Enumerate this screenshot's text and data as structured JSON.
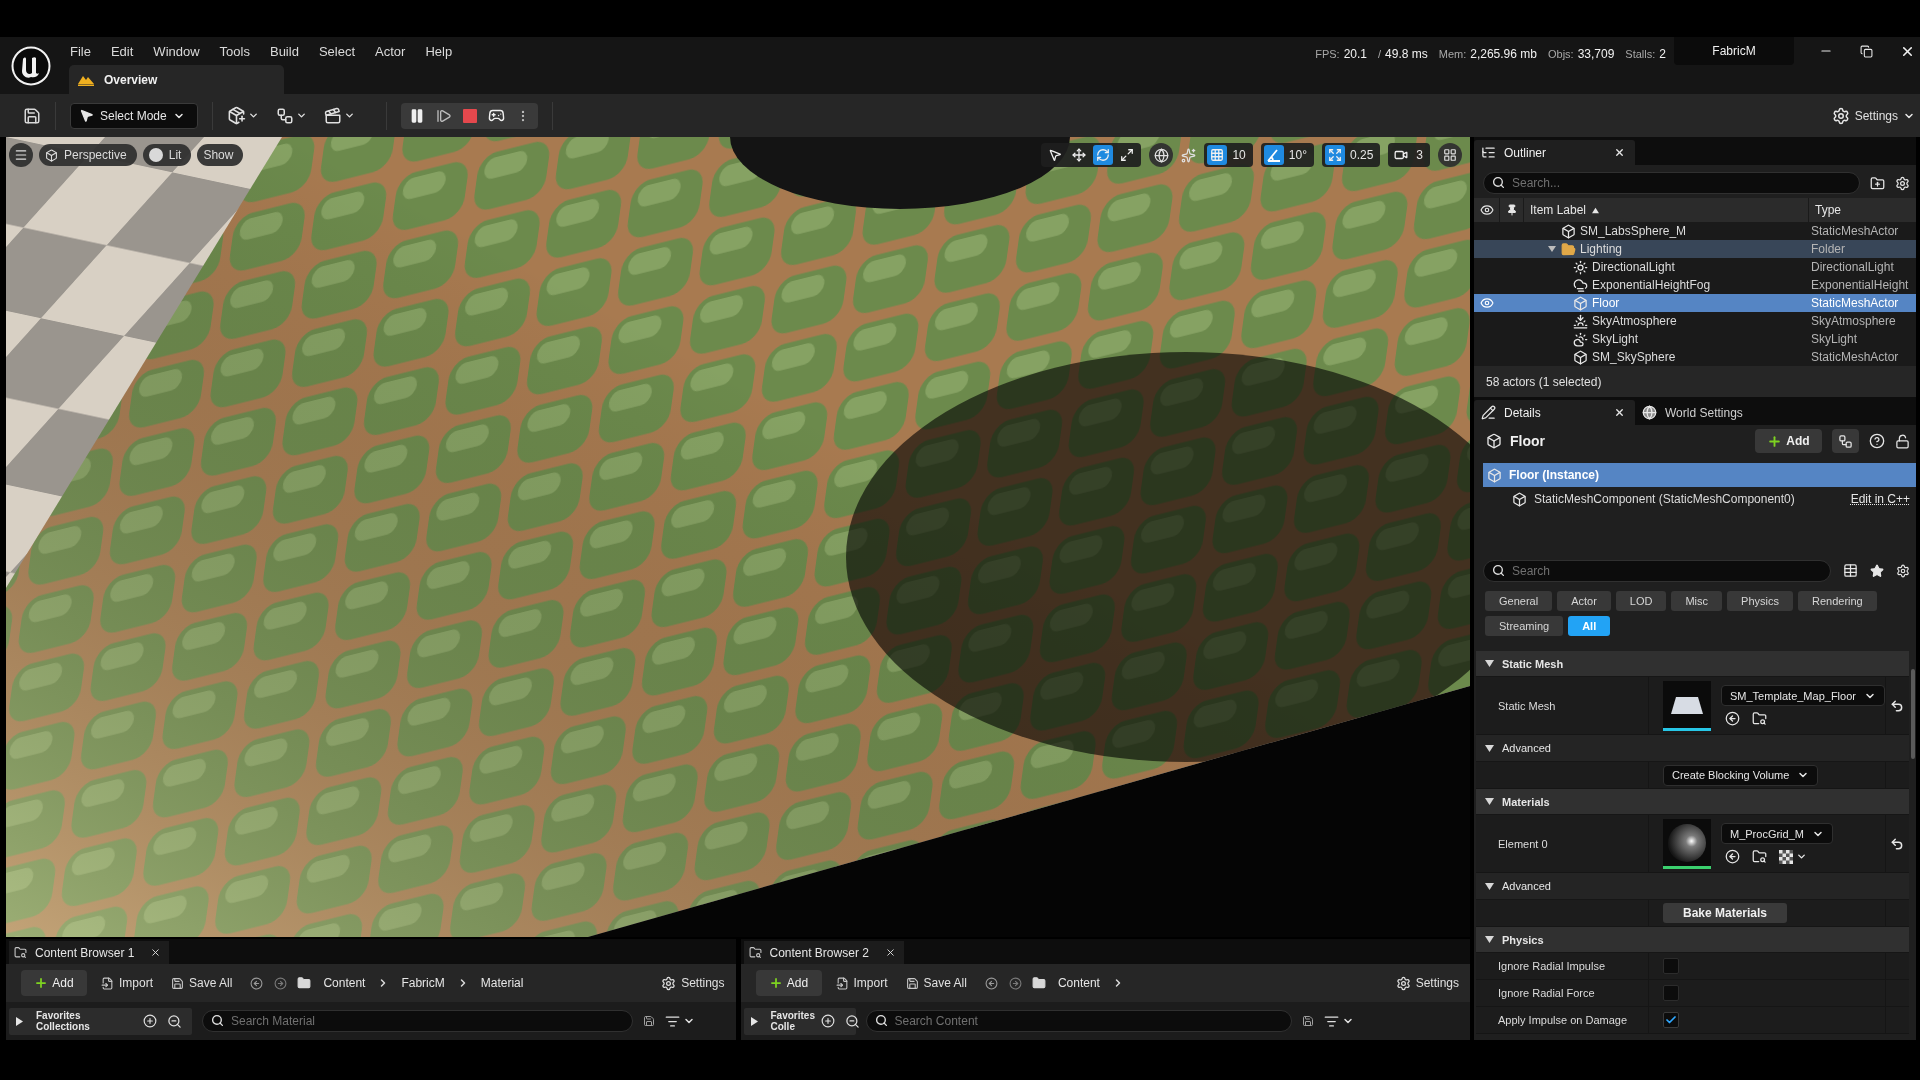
{
  "title_bar": {
    "menus": [
      "File",
      "Edit",
      "Window",
      "Tools",
      "Build",
      "Select",
      "Actor",
      "Help"
    ],
    "level_tab": "Overview",
    "stats": [
      {
        "label": "FPS:",
        "value": "20.1"
      },
      {
        "label": "/",
        "value": "49.8 ms"
      },
      {
        "label": "Mem:",
        "value": "2,265.96 mb"
      },
      {
        "label": "Objs:",
        "value": "33,709"
      },
      {
        "label": "Stalls:",
        "value": "2"
      }
    ],
    "project": "FabricM"
  },
  "toolbar": {
    "mode": "Select Mode",
    "settings": "Settings"
  },
  "viewport": {
    "menu_buttons": [
      {
        "label": "Perspective",
        "kind": "perspective"
      },
      {
        "label": "Lit",
        "kind": "lit"
      },
      {
        "label": "Show",
        "kind": "text"
      }
    ],
    "tools": [
      {
        "kind": "select",
        "selected": false
      },
      {
        "kind": "move",
        "selected": false
      },
      {
        "kind": "rotate",
        "selected": true
      },
      {
        "kind": "scale",
        "selected": false
      }
    ],
    "snaps": [
      {
        "kind": "grid",
        "value": "10",
        "on": true
      },
      {
        "kind": "angle",
        "value": "10°",
        "on": true
      },
      {
        "kind": "scale",
        "value": "0.25",
        "on": true
      },
      {
        "kind": "camera",
        "value": "3",
        "on": false
      }
    ]
  },
  "outliner": {
    "title": "Outliner",
    "search": {
      "placeholder": "Search..."
    },
    "columns": [
      "Item Label",
      "Type"
    ],
    "rows": [
      {
        "label": "SM_LabsSphere_M",
        "type": "StaticMeshActor",
        "kind": "mesh",
        "selected": false,
        "highlighted": false
      },
      {
        "label": "Lighting",
        "type": "Folder",
        "kind": "folder",
        "selected": false,
        "highlighted": true,
        "expanded": true,
        "children": [
          {
            "label": "DirectionalLight",
            "type": "DirectionalLight",
            "kind": "sun",
            "selected": false,
            "highlighted": false
          },
          {
            "label": "ExponentialHeightFog",
            "type": "ExponentialHeight",
            "kind": "fog",
            "selected": false,
            "highlighted": false
          },
          {
            "label": "Floor",
            "type": "StaticMeshActor",
            "kind": "mesh",
            "selected": true,
            "highlighted": false
          },
          {
            "label": "SkyAtmosphere",
            "type": "SkyAtmosphere",
            "kind": "atmosphere",
            "selected": false,
            "highlighted": false
          },
          {
            "label": "SkyLight",
            "type": "SkyLight",
            "kind": "skylight",
            "selected": false,
            "highlighted": false
          },
          {
            "label": "SM_SkySphere",
            "type": "StaticMeshActor",
            "kind": "mesh",
            "selected": false,
            "highlighted": false
          }
        ]
      }
    ],
    "status": "58 actors (1 selected)"
  },
  "details": {
    "tabs": [
      {
        "label": "Details",
        "selected": true
      },
      {
        "label": "World Settings",
        "selected": false
      }
    ],
    "actor": "Floor",
    "add": "Add",
    "components": [
      {
        "label": "Floor (Instance)",
        "selected": true,
        "children": [
          {
            "label": "StaticMeshComponent (StaticMeshComponent0)",
            "selected": false,
            "link": "Edit in C++"
          }
        ]
      }
    ],
    "search": {
      "placeholder": "Search"
    },
    "filters": [
      {
        "label": "General",
        "selected": false
      },
      {
        "label": "Actor",
        "selected": false
      },
      {
        "label": "LOD",
        "selected": false
      },
      {
        "label": "Misc",
        "selected": false
      },
      {
        "label": "Physics",
        "selected": false
      },
      {
        "label": "Rendering",
        "selected": false
      },
      {
        "label": "Streaming",
        "selected": false
      },
      {
        "label": "All",
        "selected": true
      }
    ],
    "sections": [
      {
        "title": "Static Mesh",
        "kind": "category",
        "expanded": true,
        "rows": [
          {
            "kind": "mesh",
            "label": "Static Mesh",
            "value": "SM_Template_Map_Floor",
            "modified": true
          }
        ]
      },
      {
        "title": "Advanced",
        "kind": "advanced",
        "expanded": true,
        "rows": [
          {
            "kind": "dropdown",
            "value": "Create Blocking Volume",
            "modified": false
          }
        ]
      },
      {
        "title": "Materials",
        "kind": "category",
        "expanded": true,
        "rows": [
          {
            "kind": "material",
            "label": "Element 0",
            "value": "M_ProcGrid_M",
            "modified": true
          }
        ]
      },
      {
        "title": "Advanced",
        "kind": "advanced",
        "expanded": true,
        "rows": [
          {
            "kind": "button",
            "value": "Bake Materials",
            "modified": false
          }
        ]
      },
      {
        "title": "Physics",
        "kind": "category",
        "expanded": true,
        "rows": [
          {
            "kind": "checkbox",
            "label": "Ignore Radial Impulse",
            "checked": false,
            "modified": false
          },
          {
            "kind": "checkbox",
            "label": "Ignore Radial Force",
            "checked": false,
            "modified": false
          },
          {
            "kind": "checkbox",
            "label": "Apply Impulse on Damage",
            "checked": true,
            "modified": false
          }
        ]
      }
    ]
  },
  "content_browsers": [
    {
      "title": "Content Browser 1",
      "actions": [
        {
          "kind": "add",
          "label": "Add"
        },
        {
          "kind": "import",
          "label": "Import"
        },
        {
          "kind": "save",
          "label": "Save All"
        }
      ],
      "path": [
        "Content",
        "FabricM",
        "Material"
      ],
      "subfolders": false,
      "settings": "Settings",
      "sidebar": [
        "Favorites",
        "Collections"
      ],
      "search": {
        "placeholder": "Search Material"
      }
    },
    {
      "title": "Content Browser 2",
      "actions": [
        {
          "kind": "add",
          "label": "Add"
        },
        {
          "kind": "import",
          "label": "Import"
        },
        {
          "kind": "save",
          "label": "Save All"
        }
      ],
      "path": [
        "Content"
      ],
      "subfolders": true,
      "settings": "Settings",
      "sidebar": [
        "Favorites",
        "Colle"
      ],
      "search": {
        "placeholder": "Search Content"
      }
    }
  ]
}
